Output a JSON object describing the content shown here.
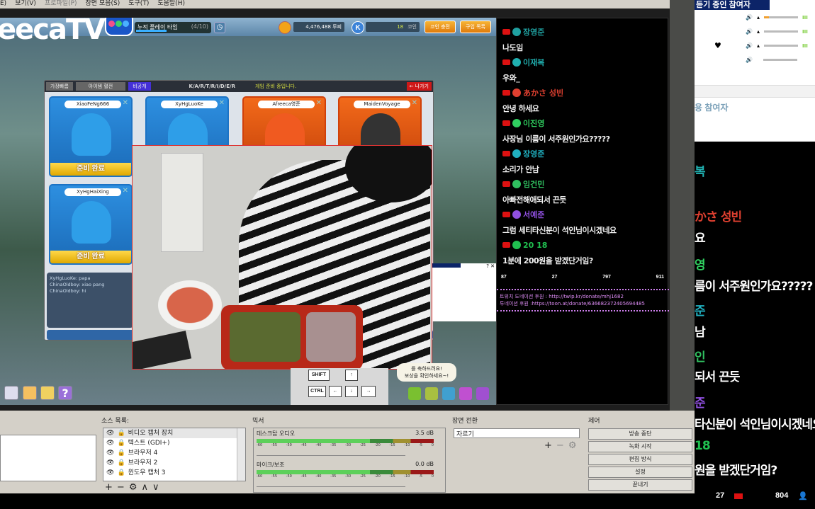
{
  "menu": [
    "E)",
    "보기(V)",
    "프로파일(P)",
    "장면 모음(S)",
    "도구(T)",
    "도움말(H)"
  ],
  "game": {
    "logo_text": "eecaTV",
    "play_time_label": "누적 플레이 타임",
    "play_time_count": "(4/10)",
    "play_time_progress": 0.4,
    "money": "4,476,488 루찌",
    "coin_count": "18",
    "coin_label": "코인",
    "buttons": [
      "코인 충전",
      "구입 목록"
    ],
    "room_tabs": [
      "가장빠름",
      "아이템 혈전",
      "비공개"
    ],
    "room_title": "K/A/R/T/R/I/D/E/R",
    "room_status": "게임 준비 중입니다.",
    "exit_button": "← 나가기",
    "players": [
      {
        "name": "XiaoFeNg666",
        "status": "준비 완료",
        "team": "blue"
      },
      {
        "name": "XyHgLuoKe",
        "status": "",
        "team": "blue"
      },
      {
        "name": "Afreeca영준",
        "status": "",
        "team": "red"
      },
      {
        "name": "MaidenVoyage",
        "status": "",
        "team": "red"
      },
      {
        "name": "XyHgHaiXing",
        "status": "준비 완료",
        "team": "blue"
      }
    ],
    "chat_log": [
      "XyHgLuoKe: papa",
      "ChinaOldboy: xiao pang",
      "ChinaOldboy: hi"
    ],
    "bubble_lines": [
      "를 축하드려요!",
      "보상을 확인하세요~!"
    ],
    "keys": {
      "shift": "SHIFT",
      "ctrl": "CTRL",
      "up": "↑",
      "left": "←",
      "down": "↓",
      "right": "→"
    }
  },
  "chat": {
    "messages": [
      {
        "user": "장영준",
        "color": "#1fa0a0",
        "text": "나도임"
      },
      {
        "user": "이재복",
        "color": "#20b0b0",
        "text": "우와_"
      },
      {
        "user": "あかさ 성빈",
        "color": "#e04030",
        "text": "안녕 하세요"
      },
      {
        "user": "이진영",
        "color": "#30d060",
        "text": "사장님 이름이 서주원인가요?????"
      },
      {
        "user": "장영준",
        "color": "#20b0c0",
        "text": "소리가 안남"
      },
      {
        "user": "임건민",
        "color": "#30c060",
        "text": "아빠전해애되서 끈듯"
      },
      {
        "user": "서예준",
        "color": "#9050e0",
        "text": "그럼 세티타신분이 석인님이시겠네요"
      },
      {
        "user": "20 18",
        "color": "#20c050",
        "text": "1분에 200원을 받겠단거임?"
      }
    ],
    "stats": [
      "87",
      "27",
      "797",
      "911"
    ],
    "donate_lines": [
      "트위치 도네이션 후원 : http://twip.kr/donate/mhj1682",
      "투네이션 후원 :https://toon.at/donate/636682372405694485"
    ]
  },
  "listeners": {
    "title": "듣기 중인 참여자",
    "section2": "용 참여자",
    "volumes": [
      0.15,
      0,
      0,
      0
    ]
  },
  "right_chat": {
    "lines": [
      {
        "text": "복",
        "color": "#20b0b0"
      },
      {
        "text": "かさ 성빈",
        "color": "#e04030"
      },
      {
        "text": "요",
        "color": "#ffffff"
      },
      {
        "text": "영",
        "color": "#30d060"
      },
      {
        "text": "름이 서주원인가요?????",
        "color": "#ffffff"
      },
      {
        "text": "준",
        "color": "#20b0c0"
      },
      {
        "text": "남",
        "color": "#ffffff"
      },
      {
        "text": "인",
        "color": "#30c060"
      },
      {
        "text": "되서 끈듯",
        "color": "#ffffff"
      },
      {
        "text": "준",
        "color": "#9050e0"
      },
      {
        "text": "타신분이 석인님이시겠네요",
        "color": "#ffffff"
      },
      {
        "text": "18",
        "color": "#20c050"
      },
      {
        "text": "원을 받겠단거임?",
        "color": "#ffffff"
      }
    ],
    "stats": [
      "27",
      "804"
    ]
  },
  "obs": {
    "sources_label": "소스 목록:",
    "sources": [
      "비디오 캡처 장치",
      "텍스트 (GDI+)",
      "브라우저 4",
      "브라우저 2",
      "윈도우 캡처 3"
    ],
    "mixer_label": "믹서",
    "mixer": [
      {
        "name": "데스크탑 오디오",
        "db": "3.5 dB",
        "level": 0.72
      },
      {
        "name": "마이크/보조",
        "db": "0.0 dB",
        "level": 0.77
      }
    ],
    "mixer_ticks": [
      "-60",
      "-55",
      "-50",
      "-45",
      "-40",
      "-35",
      "-30",
      "-25",
      "-20",
      "-15",
      "-10",
      "-5",
      "0"
    ],
    "transition_label": "장면 전환",
    "transition_value": "자르기",
    "control_label": "제어",
    "controls": [
      "방송 중단",
      "녹화 시작",
      "편집 방식",
      "설정",
      "끝내기"
    ]
  }
}
